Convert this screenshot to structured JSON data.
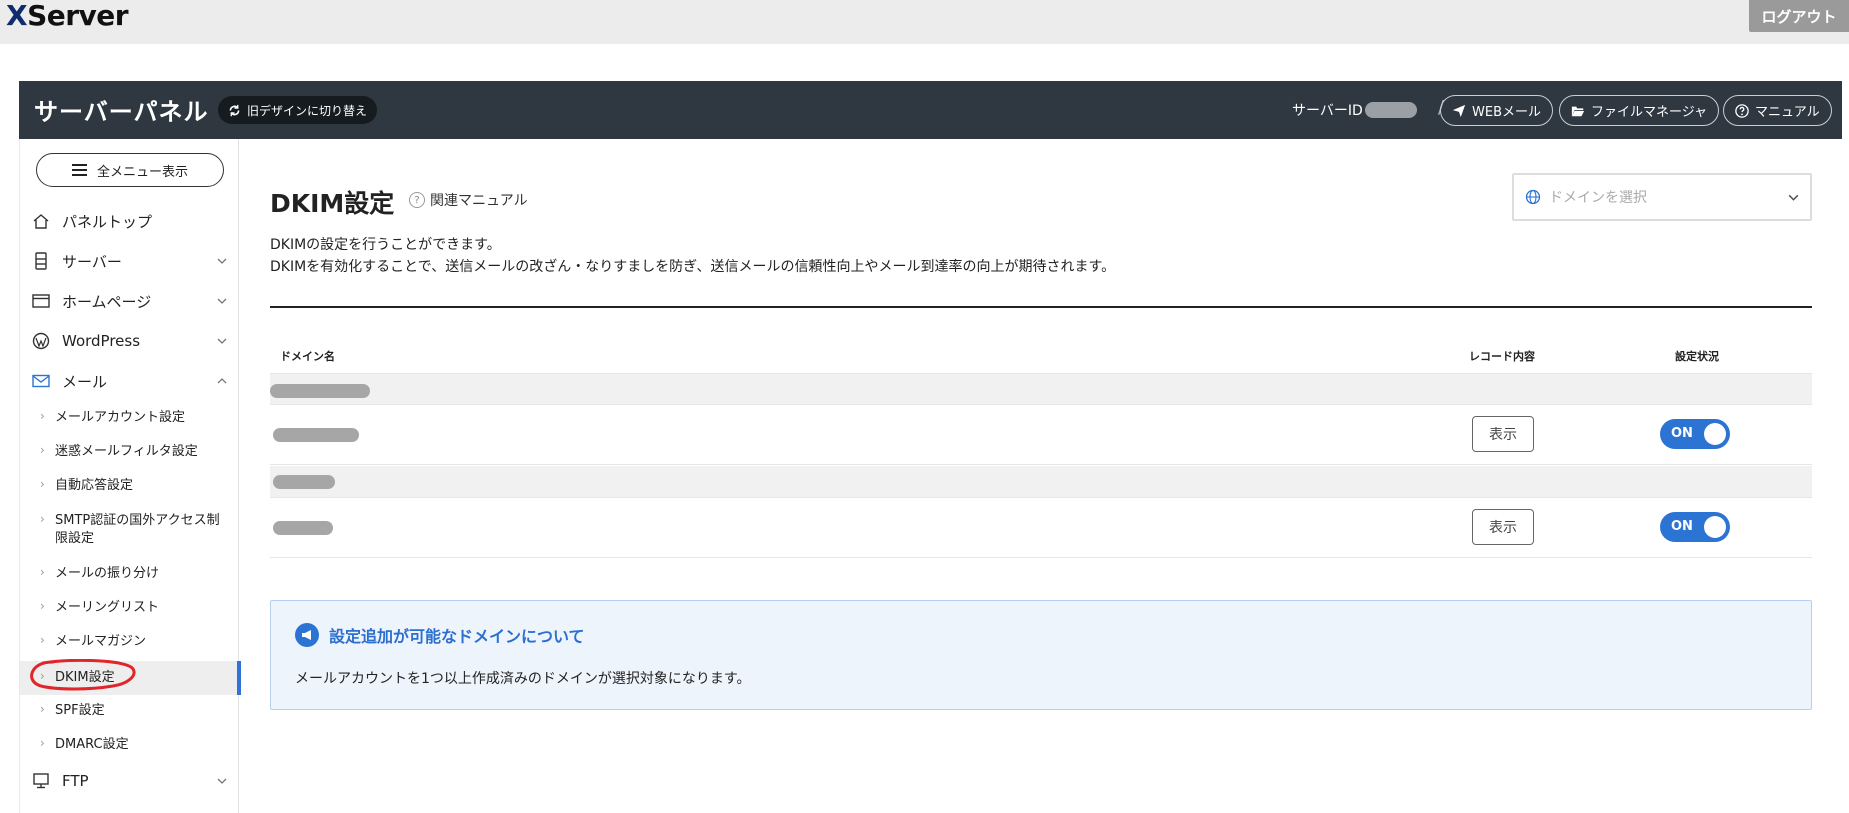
{
  "topbar": {
    "logo": "XServer",
    "logo_x": "X",
    "logo_rest": "Server",
    "logout": "ログアウト"
  },
  "panelbar": {
    "title": "サーバーパネル",
    "old_design": "旧デザインに切り替え",
    "server_id_label": "サーバーID",
    "separator": "/",
    "webmail": "WEBメール",
    "file_manager": "ファイルマネージャ",
    "manual": "マニュアル"
  },
  "sidebar": {
    "all_menu": "全メニュー表示",
    "items": [
      {
        "label": "パネルトップ",
        "icon": "home-icon"
      },
      {
        "label": "サーバー",
        "icon": "server-icon"
      },
      {
        "label": "ホームページ",
        "icon": "browser-icon"
      },
      {
        "label": "WordPress",
        "icon": "wordpress-icon"
      },
      {
        "label": "メール",
        "icon": "mail-icon"
      },
      {
        "label": "FTP",
        "icon": "monitor-icon"
      }
    ],
    "mail_sub": [
      {
        "label": "メールアカウント設定"
      },
      {
        "label": "迷惑メールフィルタ設定"
      },
      {
        "label": "自動応答設定"
      },
      {
        "label": "SMTP認証の国外アクセス制限設定",
        "line1": "SMTP認証の国外アクセス制",
        "line2": "限設定"
      },
      {
        "label": "メールの振り分け"
      },
      {
        "label": "メーリングリスト"
      },
      {
        "label": "メールマガジン"
      },
      {
        "label": "DKIM設定"
      },
      {
        "label": "SPF設定"
      },
      {
        "label": "DMARC設定"
      }
    ],
    "active": "DKIM設定"
  },
  "main": {
    "title": "DKIM設定",
    "manual_link": "関連マニュアル",
    "domain_select_placeholder": "ドメインを選択",
    "desc_line1": "DKIMの設定を行うことができます。",
    "desc_line2": "DKIMを有効化することで、送信メールの改ざん・なりすましを防ぎ、送信メールの信頼性向上やメール到達率の向上が期待されます。",
    "table": {
      "headers": [
        "ドメイン名",
        "レコード内容",
        "設定状況"
      ],
      "rows": [
        {
          "type": "group"
        },
        {
          "type": "domain",
          "button": "表示",
          "status": "ON"
        },
        {
          "type": "group"
        },
        {
          "type": "domain",
          "button": "表示",
          "status": "ON"
        }
      ]
    },
    "info": {
      "title": "設定追加が可能なドメインについて",
      "body": "メールアカウントを1つ以上作成済みのドメインが選択対象になります。"
    }
  },
  "colors": {
    "accent": "#2b74d4",
    "header_bg": "#2f3741",
    "annotation": "#e0262b"
  }
}
